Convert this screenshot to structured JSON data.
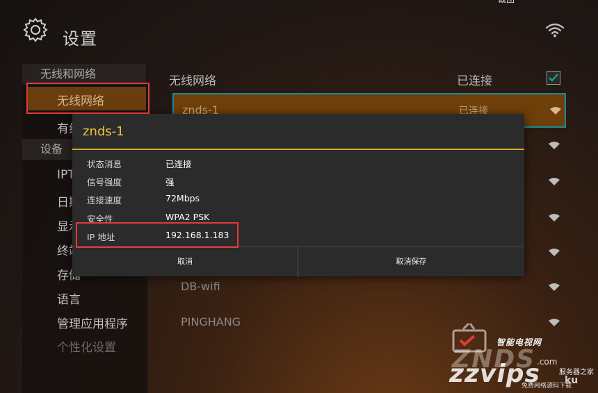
{
  "top_caption": "截图",
  "header": {
    "title": "设置",
    "icons": [
      "gear-icon",
      "wifi-icon"
    ]
  },
  "sidebar": {
    "categories": [
      "无线和网络",
      "设备"
    ],
    "selected": "无线网络",
    "items": [
      "有线网络",
      "IPTV",
      "日期",
      "显示",
      "终端",
      "存储",
      "语言",
      "管理应用程序",
      "个性化设置"
    ]
  },
  "main": {
    "heading": "无线网络",
    "status": "已连接",
    "checked": true,
    "networks": [
      {
        "name": "znds-1",
        "status": "已连接",
        "selected": true
      },
      {
        "name": "",
        "status": ""
      },
      {
        "name": "",
        "status": ""
      },
      {
        "name": "",
        "status": ""
      },
      {
        "name": "",
        "status": ""
      },
      {
        "name": "DB-wifi",
        "status": ""
      },
      {
        "name": "PINGHANG",
        "status": ""
      }
    ]
  },
  "dialog": {
    "title": "znds-1",
    "rows": [
      {
        "label": "状态消息",
        "value": "已连接"
      },
      {
        "label": "信号强度",
        "value": "强"
      },
      {
        "label": "连接速度",
        "value": "72Mbps"
      },
      {
        "label": "安全性",
        "value": "WPA2 PSK"
      },
      {
        "label": "IP 地址",
        "value": "192.168.1.183"
      }
    ],
    "buttons": [
      "取消",
      "取消保存"
    ]
  },
  "watermark": {
    "brand": "智能电视网",
    "znds": "ZNDS",
    "zzvips": "zzvips",
    "com": ".com",
    "server": "服务器之家",
    "ku": "ku",
    "tagline": "免费网络源码下载"
  },
  "colors": {
    "accent": "#f0c23a",
    "selected_bg": "#6e3f08",
    "highlight": "#e23a3a",
    "focus": "#1a8aa0"
  }
}
